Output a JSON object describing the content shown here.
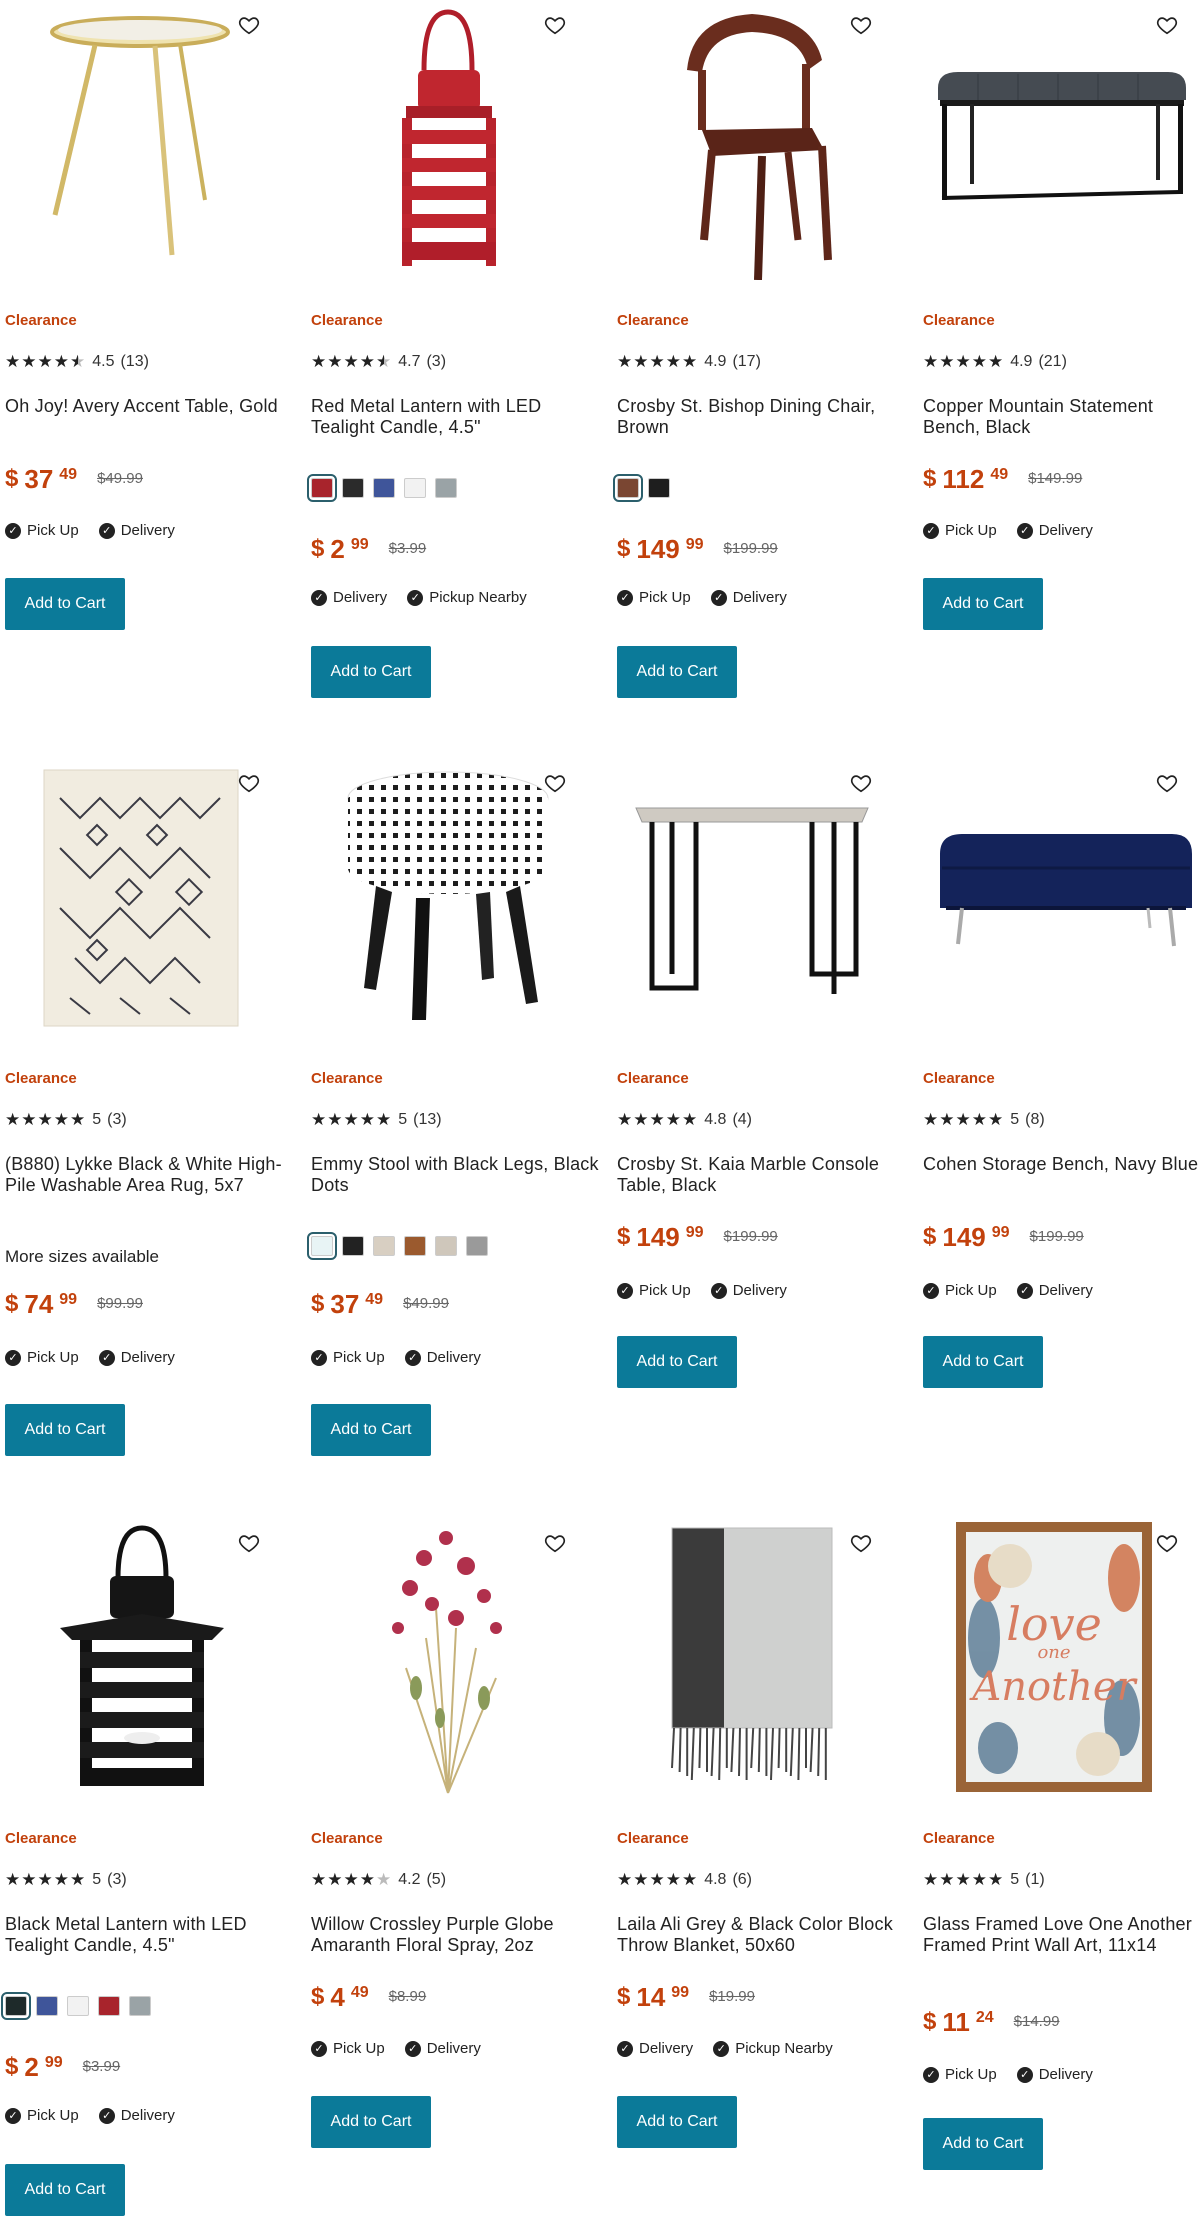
{
  "products": [
    {
      "badge": "Clearance",
      "rating": "4.5",
      "reviews": "(13)",
      "stars": "4.5",
      "title": "Oh Joy! Avery Accent Table, Gold",
      "price_dollars": "37",
      "price_cents": "49",
      "was": "$49.99",
      "currency": "$",
      "fulfillment": [
        "Pick Up",
        "Delivery"
      ],
      "button": "Add to Cart",
      "image": "gold-accent-table",
      "swatches": []
    },
    {
      "badge": "Clearance",
      "rating": "4.7",
      "reviews": "(3)",
      "stars": "4.5",
      "title": "Red Metal Lantern with LED Tealight Candle, 4.5\"",
      "price_dollars": "2",
      "price_cents": "99",
      "was": "$3.99",
      "currency": "$",
      "fulfillment": [
        "Delivery",
        "Pickup Nearby"
      ],
      "button": "Add to Cart",
      "image": "red-lantern",
      "swatches": [
        "#a8242c",
        "#2b2b2b",
        "#3f559a",
        "#f2f2f2",
        "#9aa3a6"
      ]
    },
    {
      "badge": "Clearance",
      "rating": "4.9",
      "reviews": "(17)",
      "stars": "5",
      "title": "Crosby St. Bishop Dining Chair, Brown",
      "price_dollars": "149",
      "price_cents": "99",
      "was": "$199.99",
      "currency": "$",
      "fulfillment": [
        "Pick Up",
        "Delivery"
      ],
      "button": "Add to Cart",
      "image": "dining-chair",
      "swatches": [
        "#7a4632",
        "#1e1e1e"
      ]
    },
    {
      "badge": "Clearance",
      "rating": "4.9",
      "reviews": "(21)",
      "stars": "5",
      "title": "Copper Mountain Statement Bench, Black",
      "price_dollars": "112",
      "price_cents": "49",
      "was": "$149.99",
      "currency": "$",
      "fulfillment": [
        "Pick Up",
        "Delivery"
      ],
      "button": "Add to Cart",
      "image": "black-bench",
      "swatches": []
    },
    {
      "badge": "Clearance",
      "rating": "5",
      "reviews": "(3)",
      "stars": "5",
      "title": "(B880) Lykke Black & White High-Pile Washable Area Rug, 5x7",
      "more": "More sizes available",
      "price_dollars": "74",
      "price_cents": "99",
      "was": "$99.99",
      "currency": "$",
      "fulfillment": [
        "Pick Up",
        "Delivery"
      ],
      "button": "Add to Cart",
      "image": "area-rug",
      "swatches": []
    },
    {
      "badge": "Clearance",
      "rating": "5",
      "reviews": "(13)",
      "stars": "5",
      "title": "Emmy Stool with Black Legs, Black Dots",
      "price_dollars": "37",
      "price_cents": "49",
      "was": "$49.99",
      "currency": "$",
      "fulfillment": [
        "Pick Up",
        "Delivery"
      ],
      "button": "Add to Cart",
      "image": "dot-stool",
      "swatches": [
        "#e8f4f5",
        "#222222",
        "#d8cfc2",
        "#9b5a2e",
        "#cfc7bb",
        "#9a9a9a"
      ]
    },
    {
      "badge": "Clearance",
      "rating": "4.8",
      "reviews": "(4)",
      "stars": "5",
      "title": "Crosby St. Kaia Marble Console Table, Black",
      "price_dollars": "149",
      "price_cents": "99",
      "was": "$199.99",
      "currency": "$",
      "fulfillment": [
        "Pick Up",
        "Delivery"
      ],
      "button": "Add to Cart",
      "image": "console-table",
      "swatches": []
    },
    {
      "badge": "Clearance",
      "rating": "5",
      "reviews": "(8)",
      "stars": "5",
      "title": "Cohen Storage Bench, Navy Blue",
      "price_dollars": "149",
      "price_cents": "99",
      "was": "$199.99",
      "currency": "$",
      "fulfillment": [
        "Pick Up",
        "Delivery"
      ],
      "button": "Add to Cart",
      "image": "navy-bench",
      "swatches": []
    },
    {
      "badge": "Clearance",
      "rating": "5",
      "reviews": "(3)",
      "stars": "5",
      "title": "Black Metal Lantern with LED Tealight Candle, 4.5\"",
      "price_dollars": "2",
      "price_cents": "99",
      "was": "$3.99",
      "currency": "$",
      "fulfillment": [
        "Pick Up",
        "Delivery"
      ],
      "button": "Add to Cart",
      "image": "black-lantern",
      "swatches": [
        "#1e2a2a",
        "#3f559a",
        "#f2f2f2",
        "#a8242c",
        "#9aa3a6"
      ]
    },
    {
      "badge": "Clearance",
      "rating": "4.2",
      "reviews": "(5)",
      "stars": "4",
      "title": "Willow Crossley Purple Globe Amaranth Floral Spray, 2oz",
      "price_dollars": "4",
      "price_cents": "49",
      "was": "$8.99",
      "currency": "$",
      "fulfillment": [
        "Pick Up",
        "Delivery"
      ],
      "button": "Add to Cart",
      "image": "floral-spray",
      "swatches": []
    },
    {
      "badge": "Clearance",
      "rating": "4.8",
      "reviews": "(6)",
      "stars": "5",
      "title": "Laila Ali Grey & Black Color Block Throw Blanket, 50x60",
      "price_dollars": "14",
      "price_cents": "99",
      "was": "$19.99",
      "currency": "$",
      "fulfillment": [
        "Delivery",
        "Pickup Nearby"
      ],
      "button": "Add to Cart",
      "image": "throw-blanket",
      "swatches": []
    },
    {
      "badge": "Clearance",
      "rating": "5",
      "reviews": "(1)",
      "stars": "5",
      "title": "Glass Framed Love One Another Framed Print Wall Art, 11x14",
      "price_dollars": "11",
      "price_cents": "24",
      "was": "$14.99",
      "currency": "$",
      "fulfillment": [
        "Pick Up",
        "Delivery"
      ],
      "button": "Add to Cart",
      "image": "framed-print",
      "art_text": [
        "love",
        "one",
        "Another"
      ],
      "swatches": []
    }
  ]
}
